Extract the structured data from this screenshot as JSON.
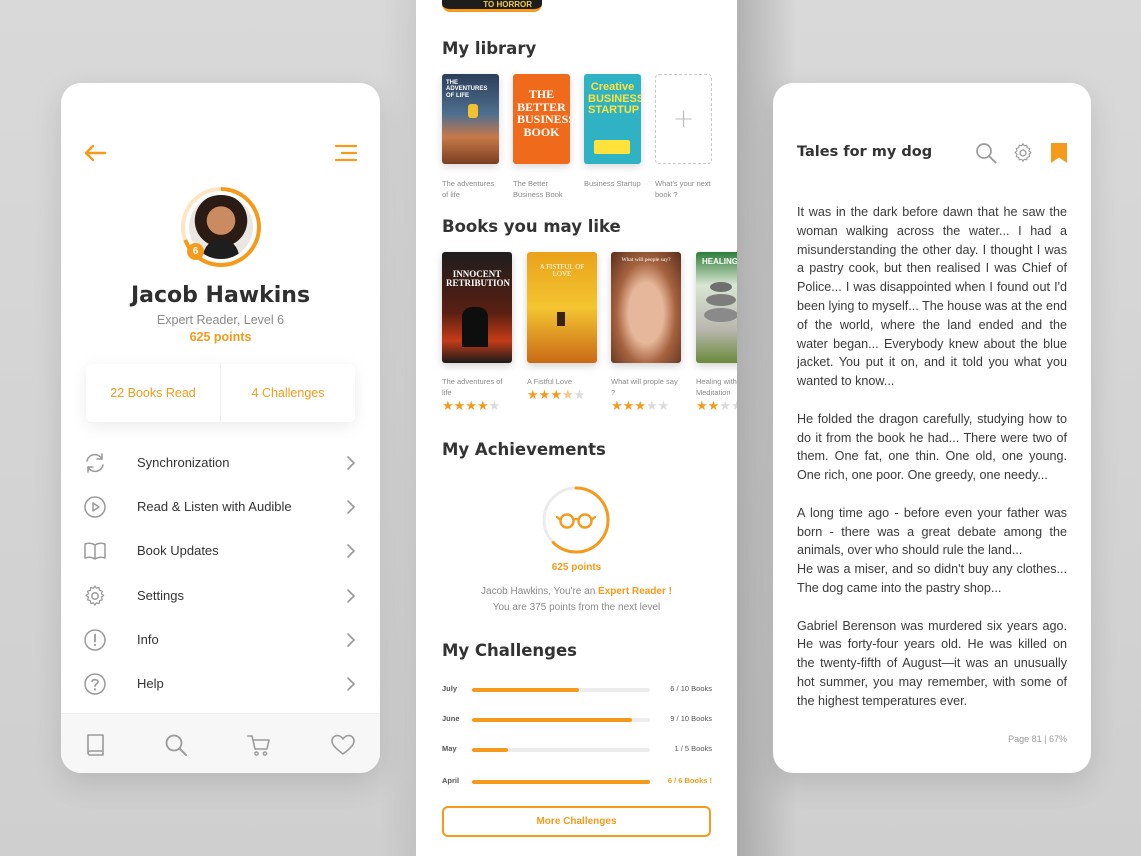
{
  "colors": {
    "accent": "#f59a1b",
    "text": "#333333",
    "muted": "#8a8a8a"
  },
  "profile": {
    "name": "Jacob Hawkins",
    "level_text": "Expert Reader, Level 6",
    "points": "625 points",
    "level_badge": "6",
    "stats": {
      "books_read": "22 Books Read",
      "challenges": "4 Challenges"
    },
    "menu": [
      {
        "label": "Synchronization",
        "icon": "sync-icon"
      },
      {
        "label": "Read & Listen with Audible",
        "icon": "play-icon"
      },
      {
        "label": "Book Updates",
        "icon": "book-open-icon"
      },
      {
        "label": "Settings",
        "icon": "gear-icon"
      },
      {
        "label": "Info",
        "icon": "info-icon"
      },
      {
        "label": "Help",
        "icon": "help-icon"
      }
    ],
    "nav": [
      "book-icon",
      "search-icon",
      "cart-icon",
      "heart-icon"
    ]
  },
  "middle": {
    "top_peek": "TO HORROR",
    "library": {
      "title": "My library",
      "books": [
        {
          "cover_text": "THE ADVENTURES OF LIFE",
          "caption": "The adventures of life"
        },
        {
          "cover_text": "THE BETTER BUSINESS BOOK",
          "caption": "The Better Business Book"
        },
        {
          "cover_text": "Creative BUSINESS STARTUP",
          "caption": "Business Startup"
        },
        {
          "caption": "What's your next book ?"
        }
      ],
      "add_symbol": "+"
    },
    "recommended": {
      "title": "Books you may like",
      "books": [
        {
          "cover_text": "INNOCENT RETRIBUTION",
          "caption": "The adventures of life",
          "rating": 4
        },
        {
          "cover_text": "A FISTFUL OF LOVE",
          "caption": "A Fistful Love",
          "rating": 3.5
        },
        {
          "cover_text": "What will people say?",
          "caption": "What will prople say ?",
          "rating": 3
        },
        {
          "cover_text": "HEALING",
          "caption": "Healing with Meditation",
          "rating": 2
        }
      ]
    },
    "achievements": {
      "title": "My Achievements",
      "points": "625 points",
      "line1_prefix": "Jacob Hawkins, You're an ",
      "line1_highlight": "Expert Reader !",
      "line2": "You are 375 points from the next level",
      "progress": 0.625
    },
    "challenges": {
      "title": "My Challenges",
      "items": [
        {
          "month": "July",
          "count": "6 / 10 Books",
          "progress": 0.6,
          "done": false
        },
        {
          "month": "June",
          "count": "9 / 10 Books",
          "progress": 0.9,
          "done": false
        },
        {
          "month": "May",
          "count": "1 / 5 Books",
          "progress": 0.2,
          "done": false
        },
        {
          "month": "April",
          "count": "6 / 6 Books !",
          "progress": 1.0,
          "done": true
        }
      ],
      "more_label": "More Challenges"
    }
  },
  "reader": {
    "title": "Tales for my dog",
    "icons": [
      "search-icon",
      "gear-icon",
      "bookmark-icon"
    ],
    "paragraphs": [
      "It was in the dark before dawn that he saw the woman walking across the water... I had a misunderstanding the other day. I thought I was a pastry cook, but then realised I was Chief of Police... I was disappointed when I found out I'd been lying to myself... The house was at the end of the world, where the land ended and the water began... Everybody knew about the blue jacket. You put it on, and it told you what you wanted to know...",
      "He folded the dragon carefully, studying how to do it from the book he had... There were two of them. One fat, one thin. One old, one young. One rich, one poor. One greedy, one needy...",
      "A long time ago - before even your father was born - there was a great debate among the animals, over who should rule the land...",
      "He was a miser, and so didn't buy any clothes... The dog came into the pastry shop...",
      "Gabriel Berenson was murdered six years ago. He was forty-four years old. He was killed on the twenty-fifth of August—it was an unusually hot summer, you may remember, with some of the highest temperatures ever."
    ],
    "page_info": "Page 81 | 67%"
  }
}
